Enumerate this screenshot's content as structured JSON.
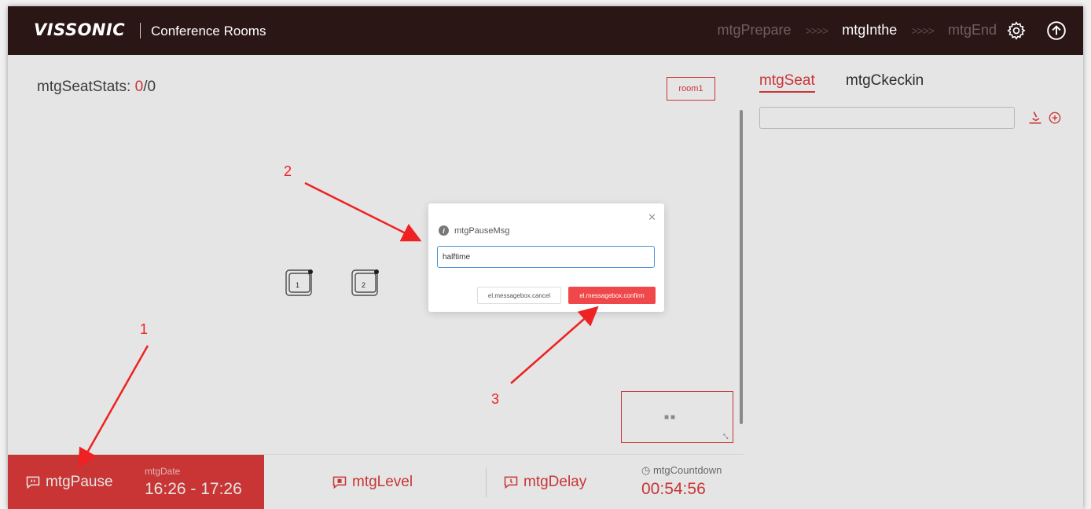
{
  "header": {
    "logo": "VISSONIC",
    "title": "Conference Rooms",
    "steps": [
      "mtgPrepare",
      "mtgInthe",
      "mtgEnd"
    ],
    "step_separator": ">>>>",
    "active_step": "mtgInthe",
    "icons": [
      "gear-icon",
      "upload-circle-icon"
    ]
  },
  "stage": {
    "seat_stats_label": "mtgSeatStats:",
    "seat_stats_count": "0",
    "seat_stats_total": "/0",
    "room_button": "room1",
    "seats": [
      "1",
      "2"
    ]
  },
  "bottom_bar": {
    "pause_label": "mtgPause",
    "date_label": "mtgDate",
    "date_value": "16:26 - 17:26",
    "level_label": "mtgLevel",
    "delay_label": "mtgDelay",
    "countdown_label": "mtgCountdown",
    "countdown_value": "00:54:56"
  },
  "right_panel": {
    "tabs": [
      "mtgSeat",
      "mtgCkeckin"
    ],
    "active_tab": "mtgSeat",
    "search_value": ""
  },
  "modal": {
    "message": "mtgPauseMsg",
    "input_value": "halftime",
    "cancel_label": "el.messagebox.cancel",
    "confirm_label": "el.messagebox.confirm"
  },
  "annotations": [
    "1",
    "2",
    "3"
  ],
  "colors": {
    "accent": "#e03b3b",
    "header_bg": "#2b1616",
    "annotation": "#ee2222"
  }
}
